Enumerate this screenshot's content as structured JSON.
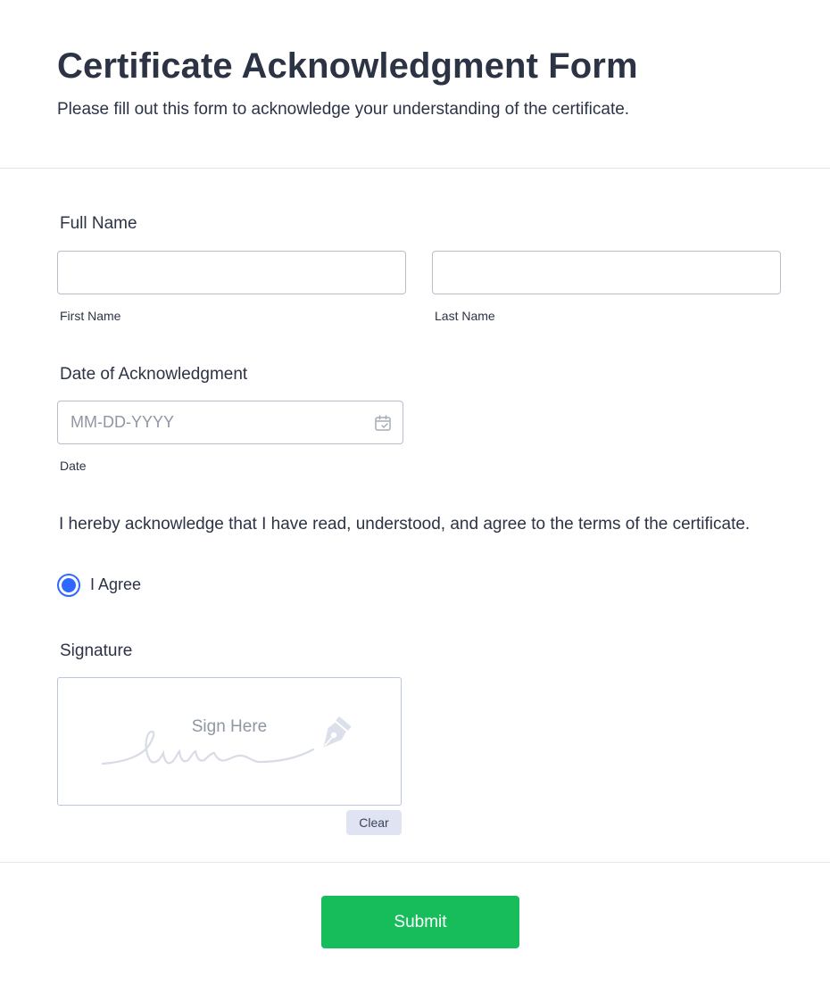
{
  "header": {
    "title": "Certificate Acknowledgment Form",
    "subtitle": "Please fill out this form to acknowledge your understanding of the certificate."
  },
  "full_name": {
    "label": "Full Name",
    "first_value": "",
    "first_sublabel": "First Name",
    "last_value": "",
    "last_sublabel": "Last Name"
  },
  "date": {
    "label": "Date of Acknowledgment",
    "placeholder": "MM-DD-YYYY",
    "value": "",
    "sublabel": "Date",
    "icon": "calendar-icon"
  },
  "acknowledgment": {
    "question": "I hereby acknowledge that I have read, understood, and agree to the terms of the certificate.",
    "option_label": "I Agree",
    "selected": true
  },
  "signature": {
    "label": "Signature",
    "placeholder": "Sign Here",
    "icon": "pen-nib-icon",
    "clear_label": "Clear"
  },
  "submit": {
    "label": "Submit"
  },
  "colors": {
    "text": "#2c3345",
    "accent_radio": "#2e69ff",
    "submit_green": "#18bd5b",
    "clear_bg": "#dfe3f2",
    "border": "#b8bdc9"
  }
}
